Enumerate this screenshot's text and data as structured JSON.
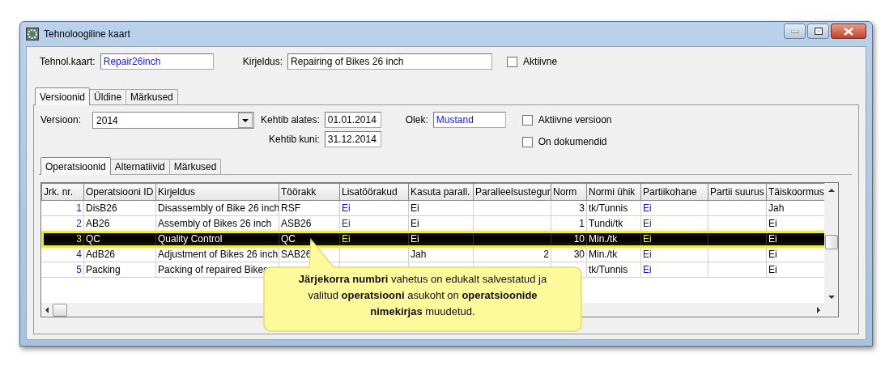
{
  "window": {
    "title": "Tehnoloogiline kaart"
  },
  "header": {
    "card_label": "Tehnol.kaart:",
    "card_value": "Repair26inch",
    "desc_label": "Kirjeldus:",
    "desc_value": "Repairing of Bikes 26 inch",
    "active": {
      "label": "Aktiivne",
      "checked": false
    }
  },
  "tabs": [
    {
      "label": "Versioonid",
      "selected": true
    },
    {
      "label": "Üldine",
      "selected": false
    },
    {
      "label": "Märkused",
      "selected": false
    }
  ],
  "version": {
    "version_label": "Versioon:",
    "version_value": "2014",
    "from_label": "Kehtib alates:",
    "from_value": "01.01.2014",
    "to_label": "Kehtib kuni:",
    "to_value": "31.12.2014",
    "state_label": "Olek:",
    "state_value": "Mustand",
    "checks": [
      {
        "label": "Aktiivne versioon",
        "checked": false
      },
      {
        "label": "On dokumendid",
        "checked": false
      }
    ]
  },
  "subtabs": [
    {
      "label": "Operatsioonid",
      "selected": true
    },
    {
      "label": "Alternatiivid",
      "selected": false
    },
    {
      "label": "Märkused",
      "selected": false
    }
  ],
  "table": {
    "columns": [
      {
        "label": "Jrk. nr.",
        "kind": "index"
      },
      {
        "label": "Operatsiooni ID",
        "kind": "text"
      },
      {
        "label": "Kirjeldus",
        "kind": "text"
      },
      {
        "label": "Töörakk",
        "kind": "text"
      },
      {
        "label": "Lisatöörakud",
        "kind": "link"
      },
      {
        "label": "Kasuta parall.",
        "kind": "text"
      },
      {
        "label": "Paralleelsustegur",
        "kind": "number"
      },
      {
        "label": "Norm",
        "kind": "number"
      },
      {
        "label": "Normi ühik",
        "kind": "text"
      },
      {
        "label": "Partiikohane",
        "kind": "link"
      },
      {
        "label": "Partii suurus",
        "kind": "text"
      },
      {
        "label": "Täiskoormus",
        "kind": "text"
      }
    ],
    "rows": [
      {
        "selected": false,
        "cells": [
          "1",
          "DisB26",
          "Disassembly of Bike 26 inch",
          "RSF",
          "Ei",
          "Ei",
          null,
          "3",
          "tk/Tunnis",
          "Ei",
          null,
          "Jah"
        ]
      },
      {
        "selected": false,
        "cells": [
          "2",
          "AB26",
          "Assembly of Bikes 26 inch",
          "ASB26",
          "Ei",
          "Ei",
          null,
          "1",
          "Tundi/tk",
          "Ei",
          null,
          "Ei"
        ]
      },
      {
        "selected": true,
        "cells": [
          "3",
          "QC",
          "Quality Control",
          "QC",
          "Ei",
          "Ei",
          null,
          "10",
          "Min./tk",
          "Ei",
          null,
          "Ei"
        ]
      },
      {
        "selected": false,
        "cells": [
          "4",
          "AdB26",
          "Adjustment of Bikes 26 inch",
          "SAB26",
          null,
          "Jah",
          "2",
          "30",
          "Min./tk",
          "Ei",
          null,
          "Ei"
        ]
      },
      {
        "selected": false,
        "cells": [
          "5",
          "Packing",
          "Packing of repaired Bikes",
          null,
          null,
          null,
          null,
          null,
          "tk/Tunnis",
          "Ei",
          null,
          "Ei"
        ]
      }
    ]
  },
  "callout": {
    "text": "**Järjekorra numbri** vahetus on edukalt salvestatud ja valitud **operatsiooni** asukoht on **operatsioonide nimekirjas** muudetud."
  }
}
